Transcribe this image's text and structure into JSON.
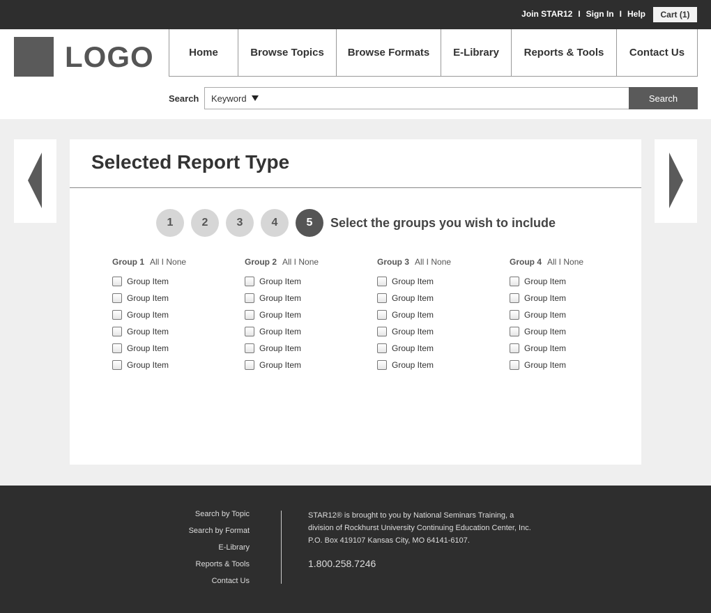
{
  "topbar": {
    "join": "Join STAR12",
    "sign_in": "Sign In",
    "help": "Help",
    "separator": "I",
    "cart": "Cart (1)"
  },
  "logo": {
    "text": "LOGO"
  },
  "nav": {
    "items": [
      "Home",
      "Browse Topics",
      "Browse Formats",
      "E-Library",
      "Reports & Tools",
      "Contact Us"
    ]
  },
  "search": {
    "label": "Search",
    "select_value": "Keyword",
    "input_value": "",
    "button": "Search"
  },
  "panel": {
    "title": "Selected Report Type",
    "steps": [
      "1",
      "2",
      "3",
      "4",
      "5"
    ],
    "active_step": "5",
    "step_label": "Select the groups you wish to include"
  },
  "groups": [
    {
      "title": "Group 1",
      "toggle": "All I None",
      "items": [
        "Group Item",
        "Group Item",
        "Group Item",
        "Group Item",
        "Group Item",
        "Group Item"
      ]
    },
    {
      "title": "Group 2",
      "toggle": "All I None",
      "items": [
        "Group Item",
        "Group Item",
        "Group Item",
        "Group Item",
        "Group Item",
        "Group Item"
      ]
    },
    {
      "title": "Group 3",
      "toggle": "All I None",
      "items": [
        "Group Item",
        "Group Item",
        "Group Item",
        "Group Item",
        "Group Item",
        "Group Item"
      ]
    },
    {
      "title": "Group 4",
      "toggle": "All I None",
      "items": [
        "Group Item",
        "Group Item",
        "Group Item",
        "Group Item",
        "Group Item",
        "Group Item"
      ]
    }
  ],
  "footer": {
    "links": [
      "Search by Topic",
      "Search by Format",
      "E-Library",
      "Reports & Tools",
      "Contact Us"
    ],
    "info_line1": "STAR12® is brought to you by National Seminars Training, a",
    "info_line2": "division of Rockhurst University Continuing Education Center, Inc.",
    "info_line3": "P.O. Box 419107 Kansas City, MO 64141-6107.",
    "phone": "1.800.258.7246"
  },
  "colors": {
    "dark_bar": "#2e2e2e",
    "accent_gray": "#5a5a5a",
    "page_bg": "#efefef"
  }
}
